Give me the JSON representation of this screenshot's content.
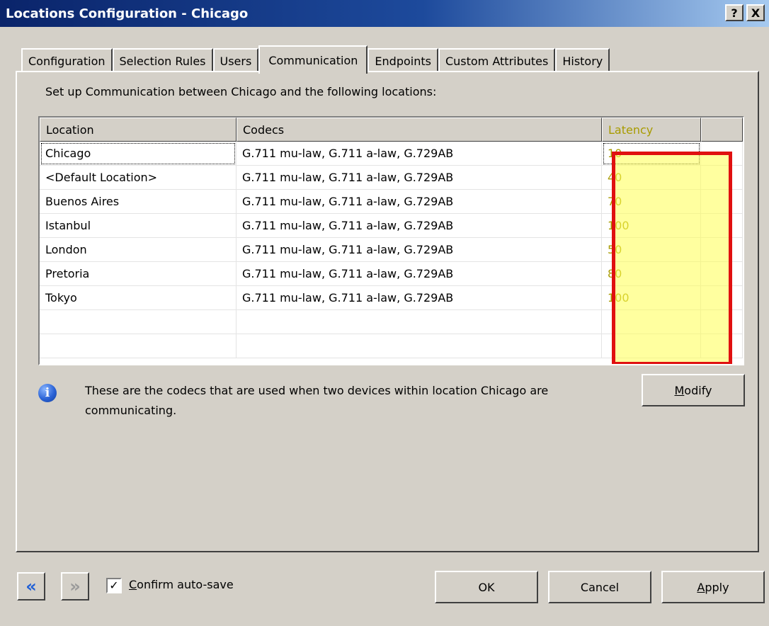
{
  "window": {
    "title": "Locations Configuration - Chicago",
    "help_glyph": "?",
    "close_glyph": "X"
  },
  "tabs": [
    {
      "label": "Configuration",
      "active": false
    },
    {
      "label": "Selection Rules",
      "active": false
    },
    {
      "label": "Users",
      "active": false
    },
    {
      "label": "Communication",
      "active": true
    },
    {
      "label": "Endpoints",
      "active": false
    },
    {
      "label": "Custom Attributes",
      "active": false
    },
    {
      "label": "History",
      "active": false
    }
  ],
  "communication": {
    "intro": "Set up Communication between Chicago and the following locations:",
    "columns": [
      "Location",
      "Codecs",
      "Latency"
    ],
    "rows": [
      {
        "location": "Chicago",
        "codecs": "G.711 mu-law, G.711 a-law, G.729AB",
        "latency": "10"
      },
      {
        "location": "<Default Location>",
        "codecs": "G.711 mu-law, G.711 a-law, G.729AB",
        "latency": "40"
      },
      {
        "location": "Buenos Aires",
        "codecs": "G.711 mu-law, G.711 a-law, G.729AB",
        "latency": "70"
      },
      {
        "location": "Istanbul",
        "codecs": "G.711 mu-law, G.711 a-law, G.729AB",
        "latency": "100"
      },
      {
        "location": "London",
        "codecs": "G.711 mu-law, G.711 a-law, G.729AB",
        "latency": "50"
      },
      {
        "location": "Pretoria",
        "codecs": "G.711 mu-law, G.711 a-law, G.729AB",
        "latency": "80"
      },
      {
        "location": "Tokyo",
        "codecs": "G.711 mu-law, G.711 a-law, G.729AB",
        "latency": "100"
      }
    ],
    "info_text": "These are the codecs that are used when two devices within location Chicago are communicating.",
    "modify_label_pre": "",
    "modify_label_key": "M",
    "modify_label_post": "odify"
  },
  "colors": {
    "highlight_fill": "#ffff50",
    "highlight_border": "#e01010",
    "titlebar": "#0a246a"
  },
  "footer": {
    "back_glyph": "«",
    "forward_glyph": "»",
    "confirm_checked": true,
    "check_glyph": "✓",
    "confirm_key": "C",
    "confirm_rest": "onfirm auto-save",
    "ok_label": "OK",
    "cancel_label": "Cancel",
    "apply_key": "A",
    "apply_rest": "pply"
  }
}
